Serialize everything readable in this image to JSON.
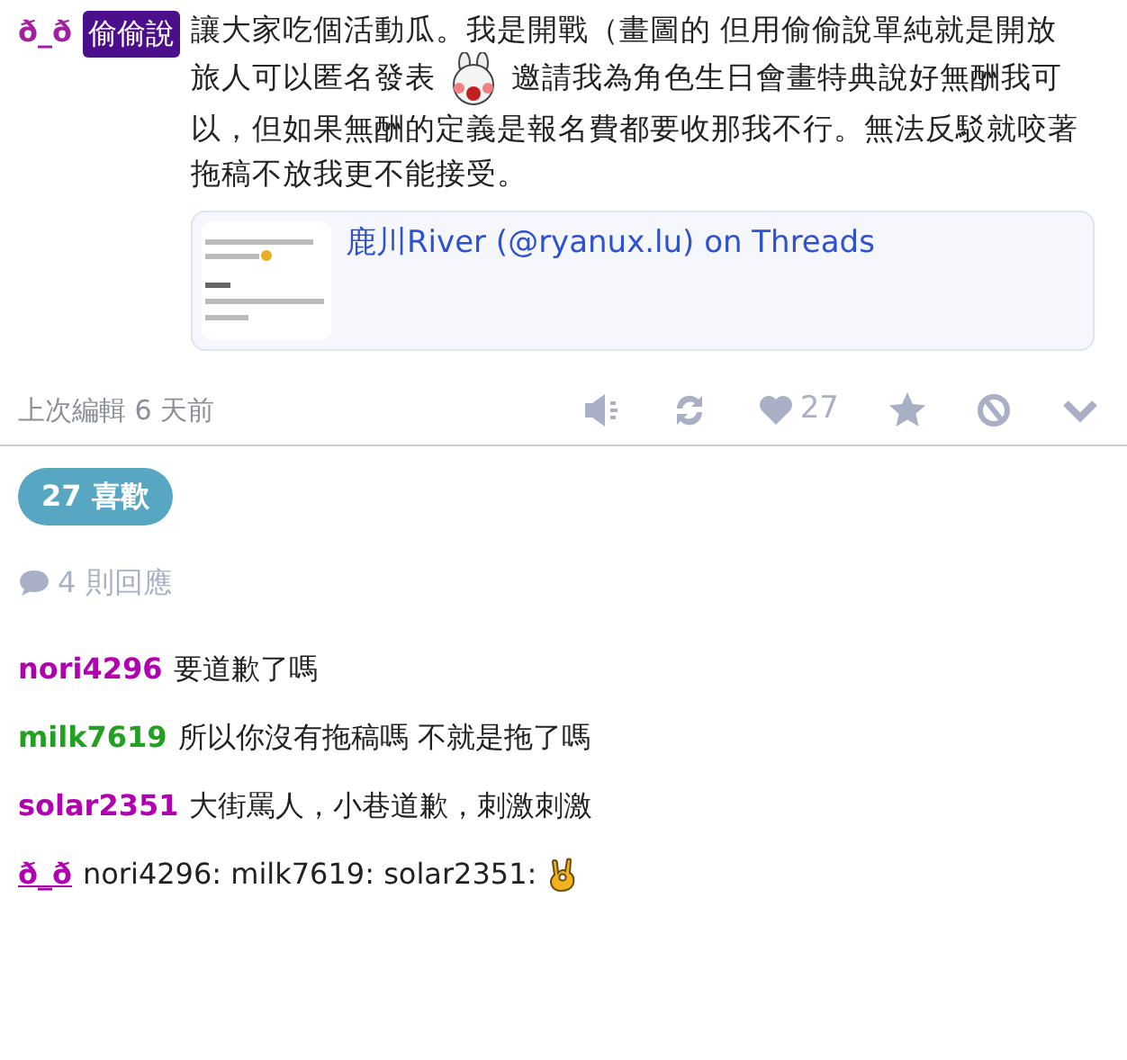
{
  "post": {
    "author": "ð_ð",
    "badge": "偷偷說",
    "text_before": "讓大家吃個活動瓜。我是開戰（畫圖的 但用偷偷說單純就是開放旅人可以匿名發表",
    "text_after": "邀請我為角色生日會畫特典說好無酬我可以，但如果無酬的定義是報名費都要收那我不行。無法反駁就咬著拖稿不放我更不能接受。",
    "link_card": {
      "title": "鹿川River (@ryanux.lu) on Threads"
    },
    "edited": "上次編輯 6 天前",
    "like_count": "27"
  },
  "likes_button": "27 喜歡",
  "reply_count": "4 則回應",
  "comments": [
    {
      "user": "nori4296",
      "color": "#b000b0",
      "text": "要道歉了嗎",
      "kind": "plain"
    },
    {
      "user": "milk7619",
      "color": "#22a022",
      "text": "所以你沒有拖稿嗎 不就是拖了嗎",
      "kind": "plain"
    },
    {
      "user": "solar2351",
      "color": "#b000b0",
      "text": "大街罵人，小巷道歉，刺激刺激",
      "kind": "plain"
    },
    {
      "user": "ð_ð",
      "color": "#b000b0",
      "text": "nori4296: milk7619: solar2351:",
      "kind": "author"
    }
  ]
}
